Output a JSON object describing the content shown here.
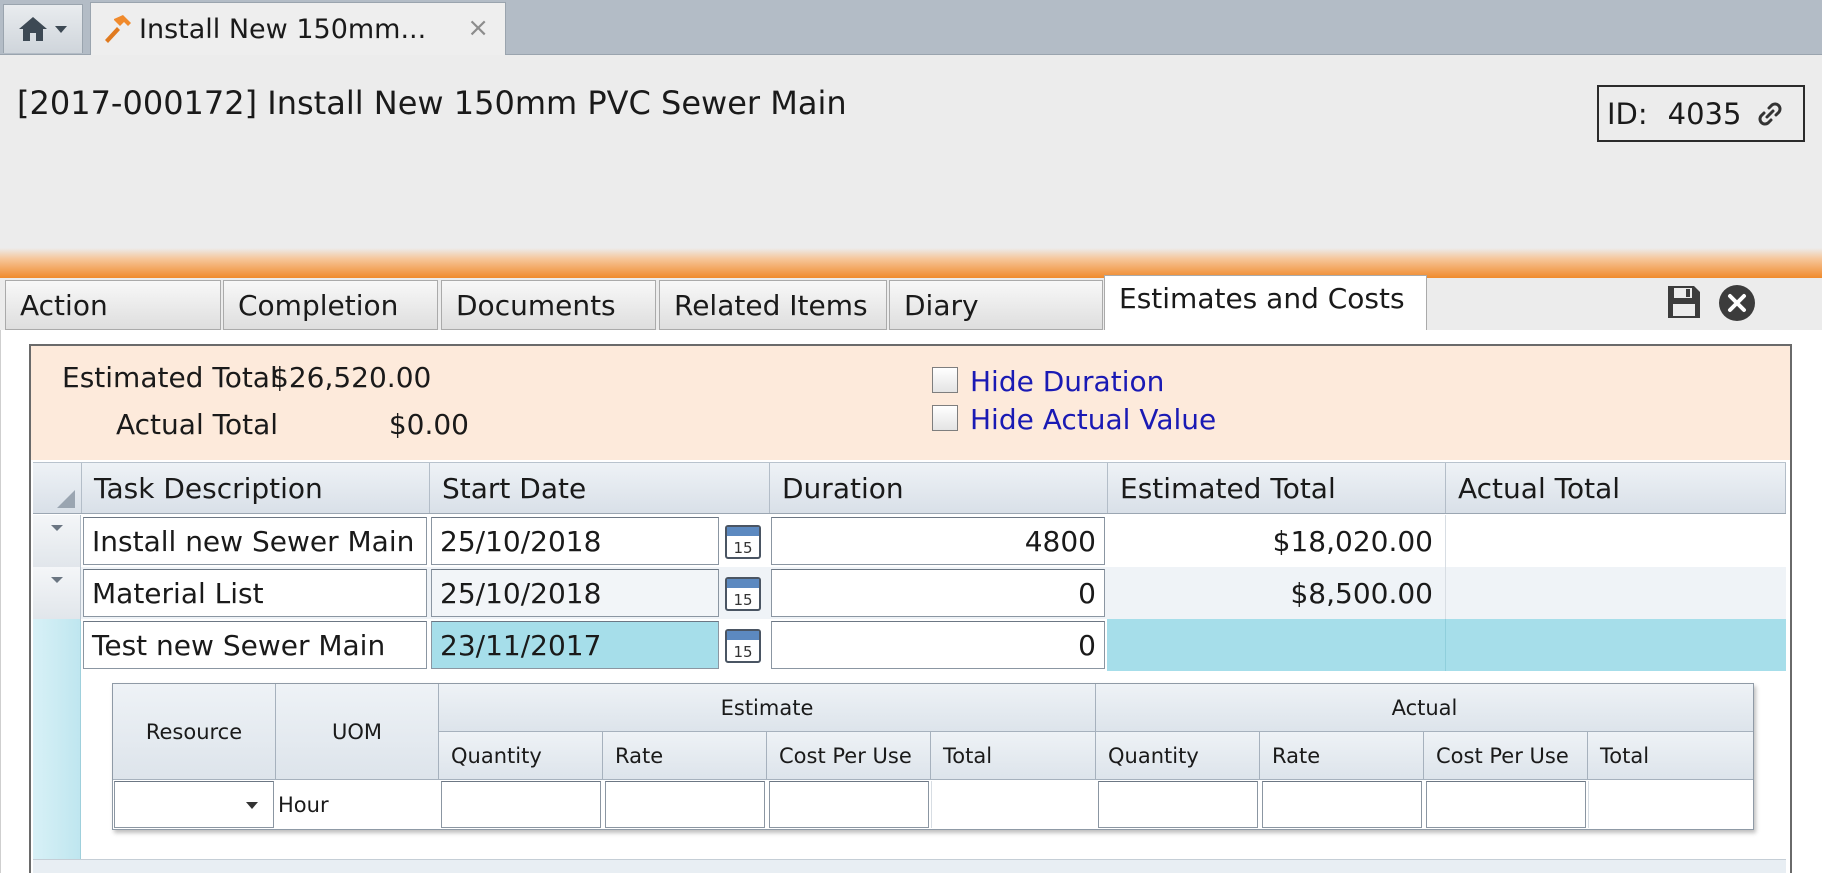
{
  "top_tabs": {
    "home_icon": "home-icon",
    "document_tab": {
      "icon": "hammer-icon",
      "label": "Install New 150mm...",
      "close_label": "×"
    }
  },
  "header": {
    "title": "[2017-000172] Install New 150mm PVC Sewer Main",
    "id_label": "ID:",
    "id_value": "4035",
    "link_icon": "link-icon"
  },
  "tabs": [
    {
      "label": "Action",
      "active": false
    },
    {
      "label": "Completion",
      "active": false
    },
    {
      "label": "Documents",
      "active": false
    },
    {
      "label": "Related Items",
      "active": false
    },
    {
      "label": "Diary",
      "active": false
    },
    {
      "label": "Estimates and Costs",
      "active": true
    }
  ],
  "tab_actions": {
    "save_icon": "save-icon",
    "close_icon": "close-circle-icon"
  },
  "summary": {
    "estimated_total_label": "Estimated Total",
    "estimated_total_value": "$26,520.00",
    "actual_total_label": "Actual Total",
    "actual_total_value": "$0.00",
    "hide_duration_label": "Hide Duration",
    "hide_actual_label": "Hide Actual Value",
    "hide_duration_checked": false,
    "hide_actual_checked": false
  },
  "grid": {
    "columns": [
      "Task Description",
      "Start Date",
      "Duration",
      "Estimated Total",
      "Actual Total"
    ],
    "rows": [
      {
        "task": "Install new Sewer Main",
        "start_date": "25/10/2018",
        "duration": "4800",
        "estimated_total": "$18,020.00",
        "actual_total": "",
        "expanded": false
      },
      {
        "task": "Material List",
        "start_date": "25/10/2018",
        "duration": "0",
        "estimated_total": "$8,500.00",
        "actual_total": "",
        "expanded": false
      },
      {
        "task": "Test new Sewer Main",
        "start_date": "23/11/2017",
        "duration": "0",
        "estimated_total": "",
        "actual_total": "",
        "expanded": true,
        "selected": true
      }
    ],
    "calendar_day": "15"
  },
  "subgrid": {
    "resource_header": "Resource",
    "uom_header": "UOM",
    "estimate_group": "Estimate",
    "actual_group": "Actual",
    "sub_columns": [
      "Quantity",
      "Rate",
      "Cost Per Use",
      "Total"
    ],
    "row": {
      "resource": "",
      "uom": "Hour"
    }
  },
  "colors": {
    "accent_orange": "#f08a2c",
    "summary_bg": "#fdeadb",
    "selected_row": "#a6deea",
    "link_text": "#1a1ab4"
  }
}
